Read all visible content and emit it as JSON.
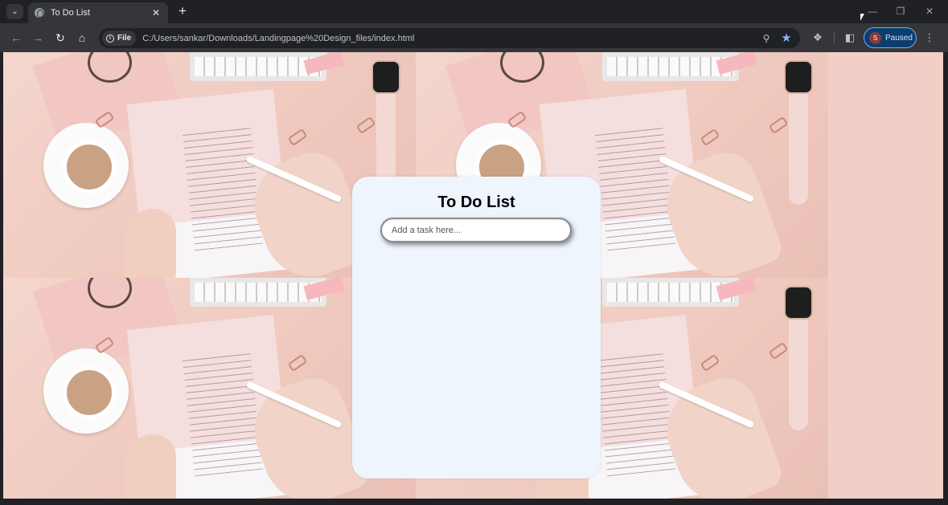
{
  "browser": {
    "tab": {
      "title": "To Do List"
    },
    "toolbar": {
      "site_chip_label": "File",
      "url": "C:/Users/sankar/Downloads/Landingpage%20Design_files/index.html",
      "profile": {
        "initial": "S",
        "label": "Paused"
      }
    },
    "icons": {
      "tab_search": "chevron-down-icon",
      "new_tab": "plus-icon",
      "back": "arrow-left-icon",
      "forward": "arrow-right-icon",
      "reload": "reload-icon",
      "home": "home-icon",
      "zoom": "zoom-icon",
      "bookmark": "star-icon",
      "extensions": "puzzle-icon",
      "side_panel": "side-panel-icon",
      "menu": "kebab-menu-icon"
    },
    "colors": {
      "frame": "#202124",
      "toolbar": "#35363a",
      "bookmark_star": "#8ab4f8",
      "profile_bg": "#0b3d6e"
    }
  },
  "page": {
    "title": "To Do List",
    "task_input": {
      "placeholder": "Add a task here...",
      "value": ""
    },
    "colors": {
      "card_bg": "#eef5fd",
      "background": "#f1cfc6"
    }
  }
}
